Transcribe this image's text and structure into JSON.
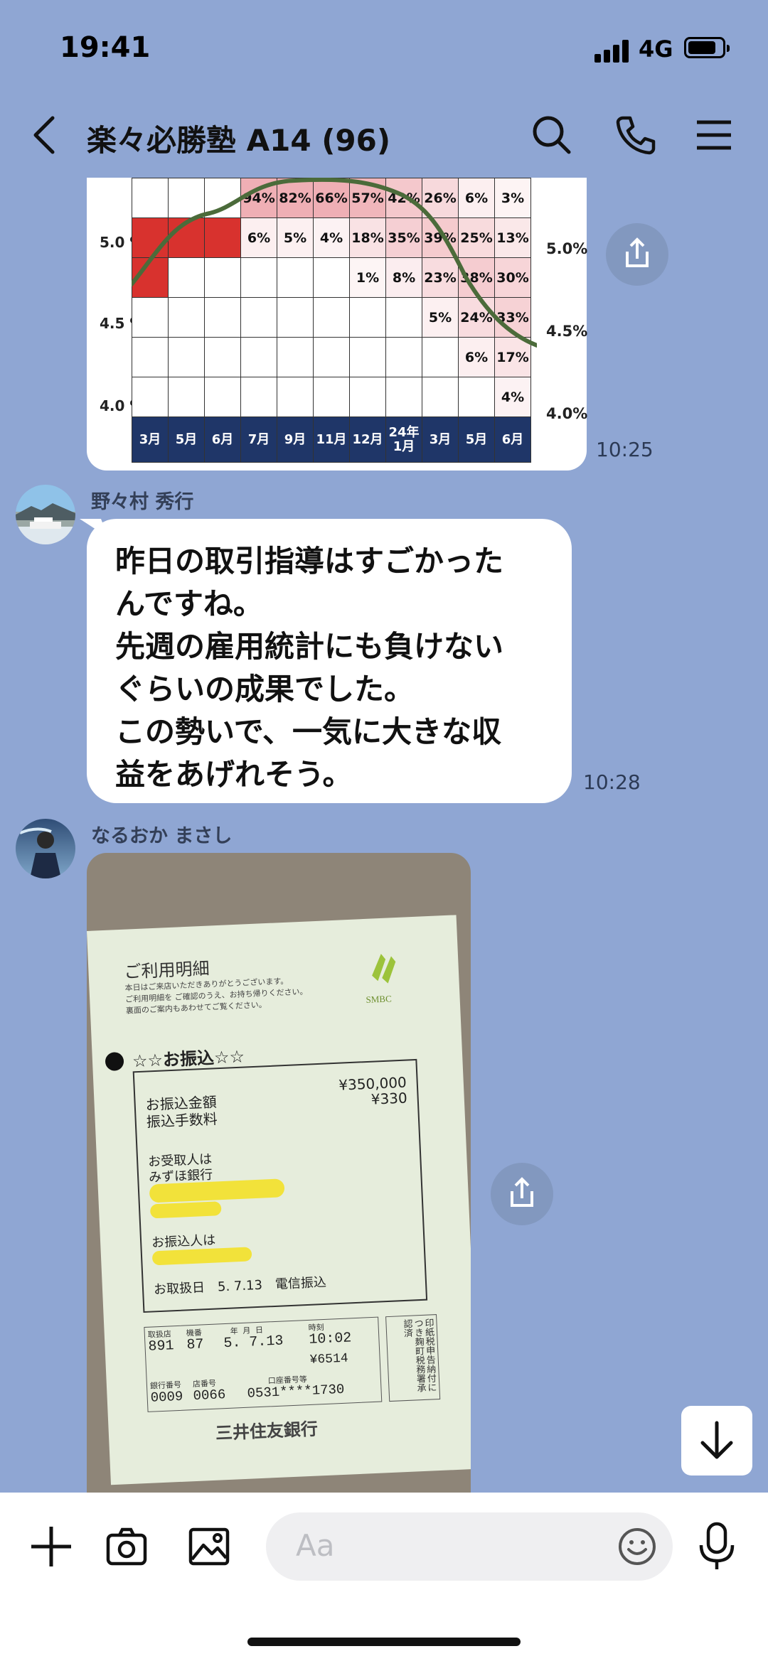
{
  "status": {
    "time": "19:41",
    "network": "4G"
  },
  "header": {
    "title": "楽々必勝塾 A14 (96)"
  },
  "chart_data": {
    "type": "table",
    "columns": [
      "3月",
      "5月",
      "6月",
      "7月",
      "9月",
      "11月",
      "12月",
      "24年\n1月",
      "3月",
      "5月",
      "6月"
    ],
    "left_axis": [
      "5.0\n%",
      "4.5\n%",
      "4.0\n%"
    ],
    "right_axis": [
      "5.0%",
      "4.5%",
      "4.0%"
    ],
    "rows": [
      [
        "",
        "",
        "",
        "94%",
        "82%",
        "66%",
        "57%",
        "42%",
        "26%",
        "6%",
        "3%"
      ],
      [
        "",
        "",
        "",
        "6%",
        "5%",
        "4%",
        "18%",
        "35%",
        "39%",
        "25%",
        "13%"
      ],
      [
        "",
        "",
        "",
        "",
        "",
        "",
        "1%",
        "8%",
        "23%",
        "38%",
        "30%"
      ],
      [
        "",
        "",
        "",
        "",
        "",
        "",
        "",
        "",
        "5%",
        "24%",
        "33%"
      ],
      [
        "",
        "",
        "",
        "",
        "",
        "",
        "",
        "",
        "",
        "6%",
        "17%"
      ],
      [
        "",
        "",
        "",
        "",
        "",
        "",
        "",
        "",
        "",
        "",
        "4%"
      ]
    ],
    "highlight_color": "#d8322e",
    "line_color": "#4b6b3a"
  },
  "messages": [
    {
      "time": "10:25"
    },
    {
      "sender": "野々村 秀行",
      "lines": [
        "昨日の取引指導はすごかった",
        "んですね。",
        "先週の雇用統計にも負けない",
        "ぐらいの成果でした。",
        "この勢いで、一気に大きな収",
        "益をあげれそう。"
      ],
      "time": "10:28"
    },
    {
      "sender": "なるおか まさし"
    }
  ],
  "receipt": {
    "title": "ご利用明細",
    "note1": "本日はご来店いただきありがとうございます。",
    "note2": "ご利用明細を ご確認のうえ、お持ち帰りください。",
    "note3": "裏面のご案内もあわせてご覧ください。",
    "brand": "SMBC",
    "heading": "☆☆お振込☆☆",
    "amount_label": "お振込金額",
    "fee_label": "振込手数料",
    "amount": "¥350,000",
    "fee": "¥330",
    "recipient_label": "お受取人は",
    "recipient_bank": "みずほ銀行",
    "sender_label": "お振込人は",
    "date_line": "お取扱日　5. 7.13　電信振込",
    "table_heads": [
      "取扱店",
      "機番",
      "年 月 日",
      "時刻"
    ],
    "table_vals": [
      "891",
      "87",
      "5. 7.13",
      "10:02"
    ],
    "serial": "¥6514",
    "acct_heads": [
      "銀行番号",
      "店番号",
      "口座番号等"
    ],
    "acct_vals": [
      "0009",
      "0066",
      "0531****1730"
    ],
    "stamp": "印紙税申告納付につき麹町税務署承認済",
    "bank_name": "三井住友銀行"
  },
  "composer": {
    "placeholder": "Aa"
  }
}
